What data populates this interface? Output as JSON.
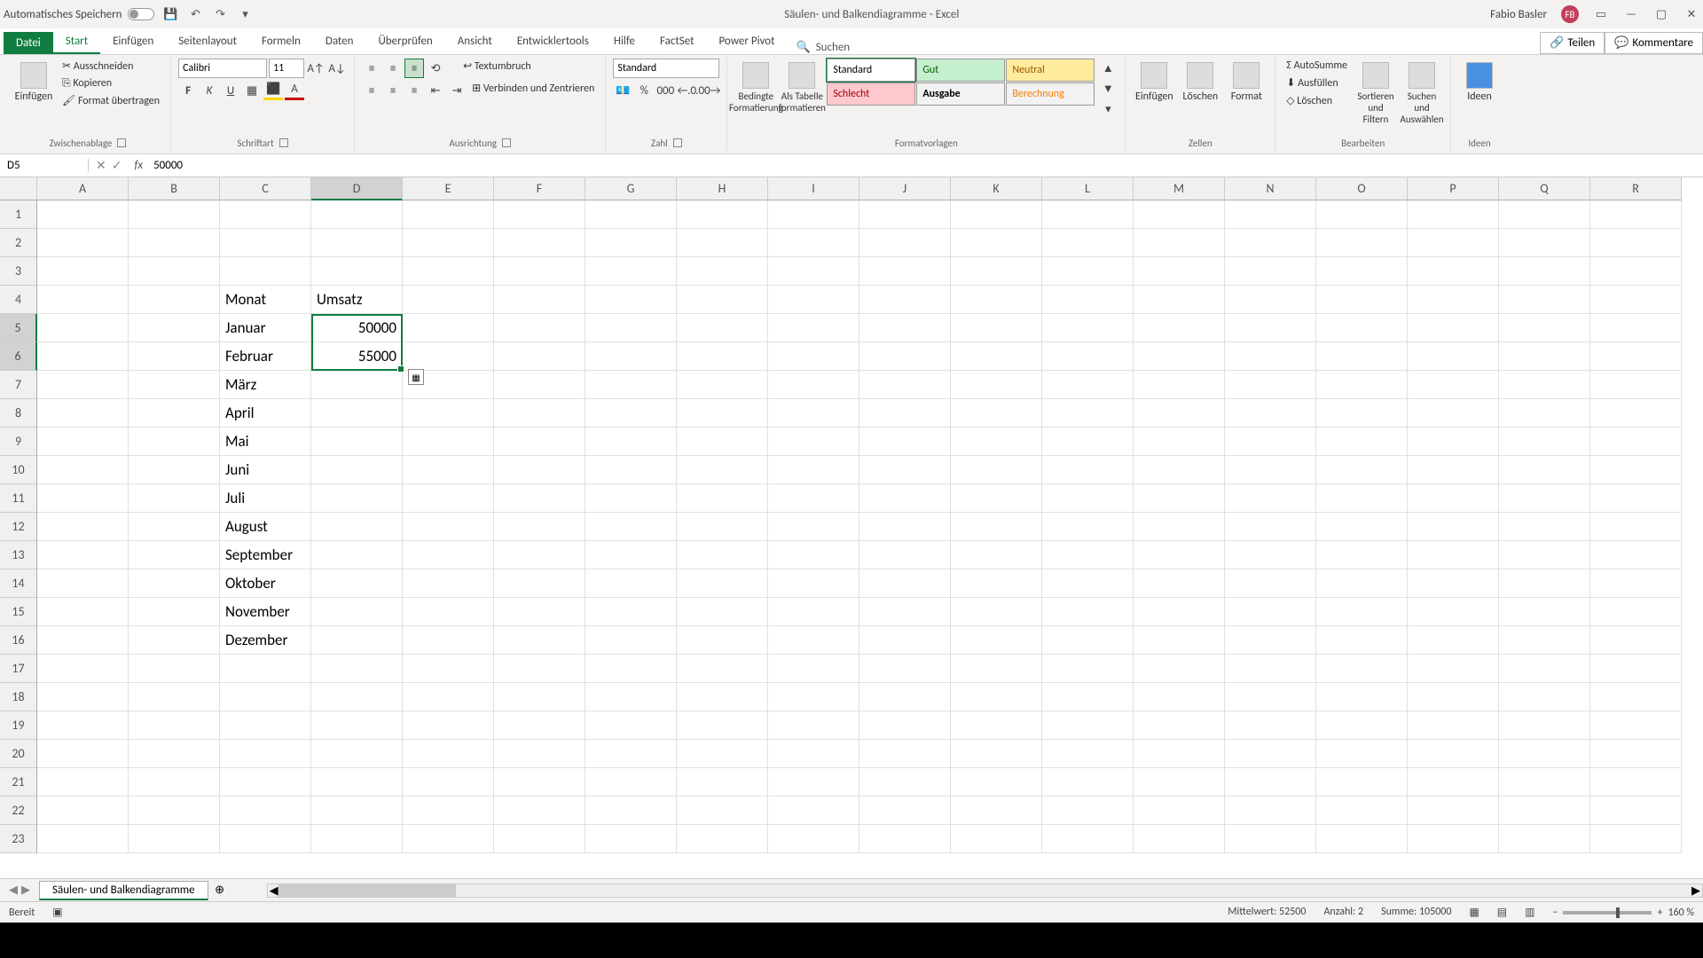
{
  "titlebar": {
    "autosave_label": "Automatisches Speichern",
    "doc_title": "Säulen- und Balkendiagramme - Excel",
    "user_name": "Fabio Basler",
    "user_initials": "FB"
  },
  "tabs": {
    "file": "Datei",
    "items": [
      "Start",
      "Einfügen",
      "Seitenlayout",
      "Formeln",
      "Daten",
      "Überprüfen",
      "Ansicht",
      "Entwicklertools",
      "Hilfe",
      "FactSet",
      "Power Pivot"
    ],
    "search": "Suchen",
    "share": "Teilen",
    "comments": "Kommentare"
  },
  "ribbon": {
    "clipboard": {
      "paste": "Einfügen",
      "cut": "Ausschneiden",
      "copy": "Kopieren",
      "brush": "Format übertragen",
      "label": "Zwischenablage"
    },
    "font": {
      "name": "Calibri",
      "size": "11",
      "label": "Schriftart"
    },
    "align": {
      "wrap": "Textumbruch",
      "merge": "Verbinden und Zentrieren",
      "label": "Ausrichtung"
    },
    "number": {
      "format": "Standard",
      "label": "Zahl"
    },
    "styles": {
      "cond": "Bedingte Formatierung",
      "table": "Als Tabelle formatieren",
      "standard": "Standard",
      "gut": "Gut",
      "neutral": "Neutral",
      "schlecht": "Schlecht",
      "ausgabe": "Ausgabe",
      "berechnung": "Berechnung",
      "label": "Formatvorlagen"
    },
    "cells": {
      "insert": "Einfügen",
      "delete": "Löschen",
      "format": "Format",
      "label": "Zellen"
    },
    "editing": {
      "sum": "AutoSumme",
      "fill": "Ausfüllen",
      "clear": "Löschen",
      "sort": "Sortieren und Filtern",
      "find": "Suchen und Auswählen",
      "label": "Bearbeiten"
    },
    "ideas": {
      "label": "Ideen"
    }
  },
  "namebox": "D5",
  "formula": "50000",
  "columns": [
    "A",
    "B",
    "C",
    "D",
    "E",
    "F",
    "G",
    "H",
    "I",
    "J",
    "K",
    "L",
    "M",
    "N",
    "O",
    "P",
    "Q",
    "R"
  ],
  "visible_rows": 23,
  "selected_col_idx": 3,
  "selected_rows": [
    5,
    6
  ],
  "cells": {
    "C4": "Monat",
    "D4": "Umsatz",
    "C5": "Januar",
    "D5": "50000",
    "C6": "Februar",
    "D6": "55000",
    "C7": "März",
    "C8": "April",
    "C9": "Mai",
    "C10": "Juni",
    "C11": "Juli",
    "C12": "August",
    "C13": "September",
    "C14": "Oktober",
    "C15": "November",
    "C16": "Dezember"
  },
  "sheet": {
    "name": "Säulen- und Balkendiagramme"
  },
  "status": {
    "ready": "Bereit",
    "avg": "Mittelwert: 52500",
    "count": "Anzahl: 2",
    "sum": "Summe: 105000",
    "zoom": "160 %"
  }
}
